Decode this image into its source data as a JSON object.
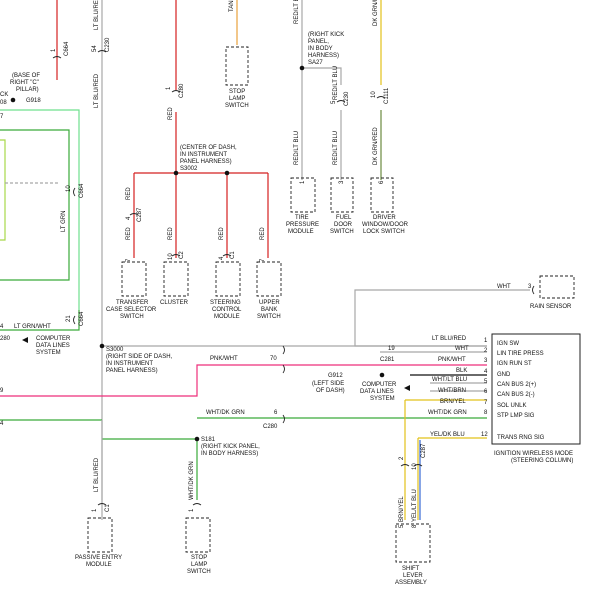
{
  "wires": {
    "lt_blu_red": "LT BLU/RED",
    "red_lt_blu": "RED/LT BLU",
    "dk_grn_red": "DK GRN/RED",
    "tan": "TAN",
    "red": "RED",
    "lt_grn": "LT GRN",
    "lt_grn_wht": "LT GRN/WHT",
    "pnk_wht": "PNK/WHT",
    "wht_dk_grn": "WHT/DK GRN",
    "wht": "WHT",
    "blk": "BLK",
    "wht_lt_blu": "WHT/LT BLU",
    "wht_brn": "WHT/BRN",
    "brn_yel": "BRN/YEL",
    "yel_dk_blu": "YEL/DK BLU",
    "yel_lt_blu": "YEL/LT BLU"
  },
  "colors": {
    "red": "#d42020",
    "pink": "#ee2e7a",
    "green": "#3aaa3a",
    "lt_green": "#6fe08e",
    "tan": "#e8a23c",
    "yellow": "#e2c21a",
    "gray": "#a8a8a8",
    "lime": "#a8d84a",
    "black": "#111111"
  },
  "connectors": {
    "c230": "C230",
    "c280": "C280",
    "c281": "C281",
    "c287": "C287",
    "c664": "C664",
    "c1": "C1",
    "c2": "C2",
    "c1111": "C1111",
    "g918": "G918",
    "g912": "G912",
    "s3002": "S3002",
    "s3000": "S3000",
    "sa27": "SA27",
    "s181": "S181"
  },
  "pins": {
    "p1": "1",
    "p2": "2",
    "p3": "3",
    "p4": "4",
    "p5": "5",
    "p6": "6",
    "p7": "7",
    "p8": "8",
    "p9": "9",
    "p10": "10",
    "p12": "12",
    "p19": "19",
    "p21": "21",
    "p28": "28",
    "p54": "54",
    "p70": "70"
  },
  "locations": {
    "base_c_pillar": [
      "(BASE OF",
      "RIGHT \"C\"",
      "PILLAR)"
    ],
    "right_kick_body": [
      "(RIGHT KICK",
      "PANEL,",
      "IN BODY",
      "HARNESS)"
    ],
    "center_dash": [
      "(CENTER OF DASH,",
      "IN INSTRUMENT",
      "PANEL HARNESS)"
    ],
    "right_side_dash": [
      "(RIGHT SIDE OF DASH,",
      "IN INSTRUMENT",
      "PANEL HARNESS)"
    ],
    "left_side_dash": [
      "(LEFT SIDE",
      "OF DASH)"
    ],
    "right_kick_body2": [
      "(RIGHT KICK PANEL,",
      "IN BODY HARNESS)"
    ]
  },
  "components": {
    "stop_lamp_top": [
      "STOP",
      "LAMP",
      "SWITCH"
    ],
    "tire_pressure": [
      "TIRE",
      "PRESSURE",
      "MODULE"
    ],
    "fuel_door": [
      "FUEL",
      "DOOR",
      "SWITCH"
    ],
    "driver_window": [
      "DRIVER",
      "WINDOW/DOOR",
      "LOCK SWITCH"
    ],
    "transfer_case": [
      "TRANSFER",
      "CASE SELECTOR",
      "SWITCH"
    ],
    "cluster": [
      "CLUSTER"
    ],
    "steering_control": [
      "STEERING",
      "CONTROL",
      "MODULE"
    ],
    "upper_bank": [
      "UPPER",
      "BANK",
      "SWITCH"
    ],
    "rain_sensor": [
      "RAIN SENSOR"
    ],
    "computer_data_left": [
      "COMPUTER",
      "DATA LINES",
      "SYSTEM"
    ],
    "computer_data_mid": [
      "COMPUTER",
      "DATA LINES",
      "SYSTEM"
    ],
    "passive_entry": [
      "PASSIVE ENTRY",
      "MODULE"
    ],
    "stop_lamp_bottom": [
      "STOP",
      "LAMP",
      "SWITCH"
    ],
    "shift_lever": [
      "SHIFT",
      "LEVER",
      "ASSEMBLY"
    ],
    "iwm": [
      "IGNITION WIRELESS MODE",
      "(STEERING COLUMN)"
    ]
  },
  "iwm_pins": [
    {
      "pin": "1",
      "name": "IGN SW"
    },
    {
      "pin": "2",
      "name": "LIN TIRE PRESS"
    },
    {
      "pin": "3",
      "name": "IGN RUN ST"
    },
    {
      "pin": "4",
      "name": "GND"
    },
    {
      "pin": "5",
      "name": "CAN BUS 2(+)"
    },
    {
      "pin": "6",
      "name": "CAN BUS 2(-)"
    },
    {
      "pin": "7",
      "name": "SOL UNLK"
    },
    {
      "pin": "8",
      "name": "STP LMP SIG"
    },
    {
      "pin": "12",
      "name": "TRANS RNG SIG"
    }
  ],
  "misc": {
    "ck": "CK",
    "left_partial": "ATE",
    "n08": "08",
    "n7": "7",
    "n4": "4",
    "n280": "280",
    "n9": "9",
    "n3": "3"
  }
}
